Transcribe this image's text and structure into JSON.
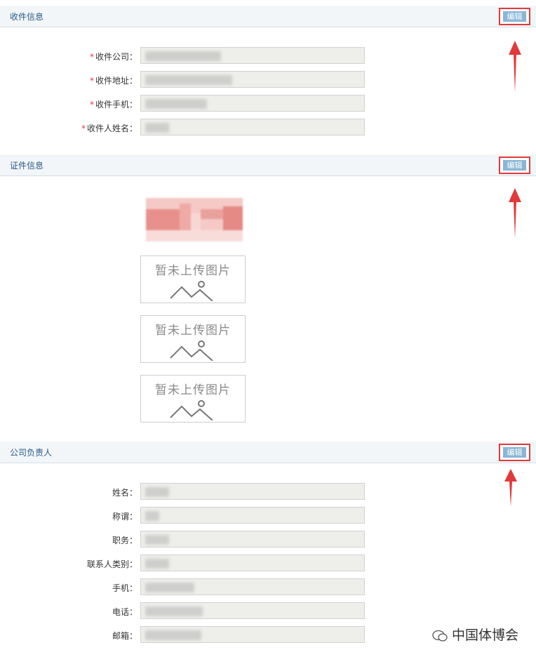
{
  "sections": {
    "receiver": {
      "title": "收件信息",
      "edit_label": "编辑",
      "fields": [
        {
          "label": "收件公司：",
          "required": "*"
        },
        {
          "label": "收件地址：",
          "required": "*"
        },
        {
          "label": "收件手机：",
          "required": "*"
        },
        {
          "label": "收件人姓名：",
          "required": "*"
        }
      ]
    },
    "certificate": {
      "title": "证件信息",
      "edit_label": "编辑",
      "placeholders": [
        "暂未上传图片",
        "暂未上传图片",
        "暂未上传图片"
      ]
    },
    "principal": {
      "title": "公司负责人",
      "edit_label": "编辑",
      "fields": [
        {
          "label": "姓名："
        },
        {
          "label": "称谓："
        },
        {
          "label": "职务："
        },
        {
          "label": "联系人类别："
        },
        {
          "label": "手机："
        },
        {
          "label": "电话："
        },
        {
          "label": "邮箱："
        }
      ]
    }
  },
  "watermark": {
    "text": "中国体博会"
  },
  "colors": {
    "annotation": "#e23a3a",
    "edit_button": "#8ab6d6",
    "section_title": "#2a5a86"
  }
}
